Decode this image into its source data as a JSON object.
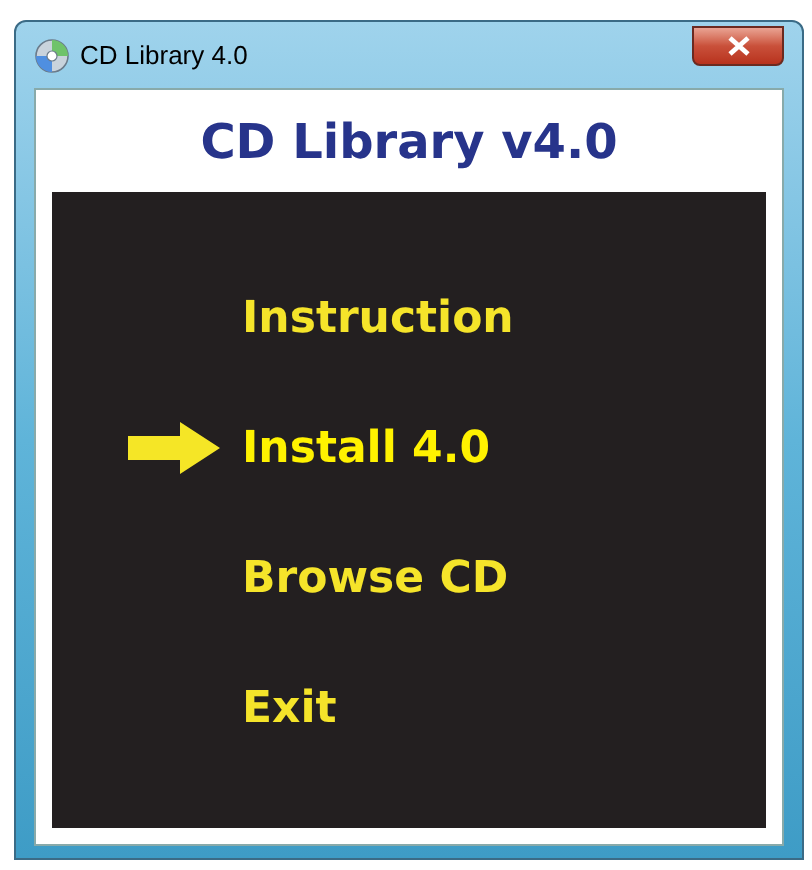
{
  "window": {
    "title": "CD Library 4.0"
  },
  "heading": "CD Library v4.0",
  "menu": [
    {
      "label": "Instruction",
      "selected": false
    },
    {
      "label": "Install 4.0",
      "selected": true
    },
    {
      "label": "Browse CD",
      "selected": false
    },
    {
      "label": "Exit",
      "selected": false
    }
  ]
}
